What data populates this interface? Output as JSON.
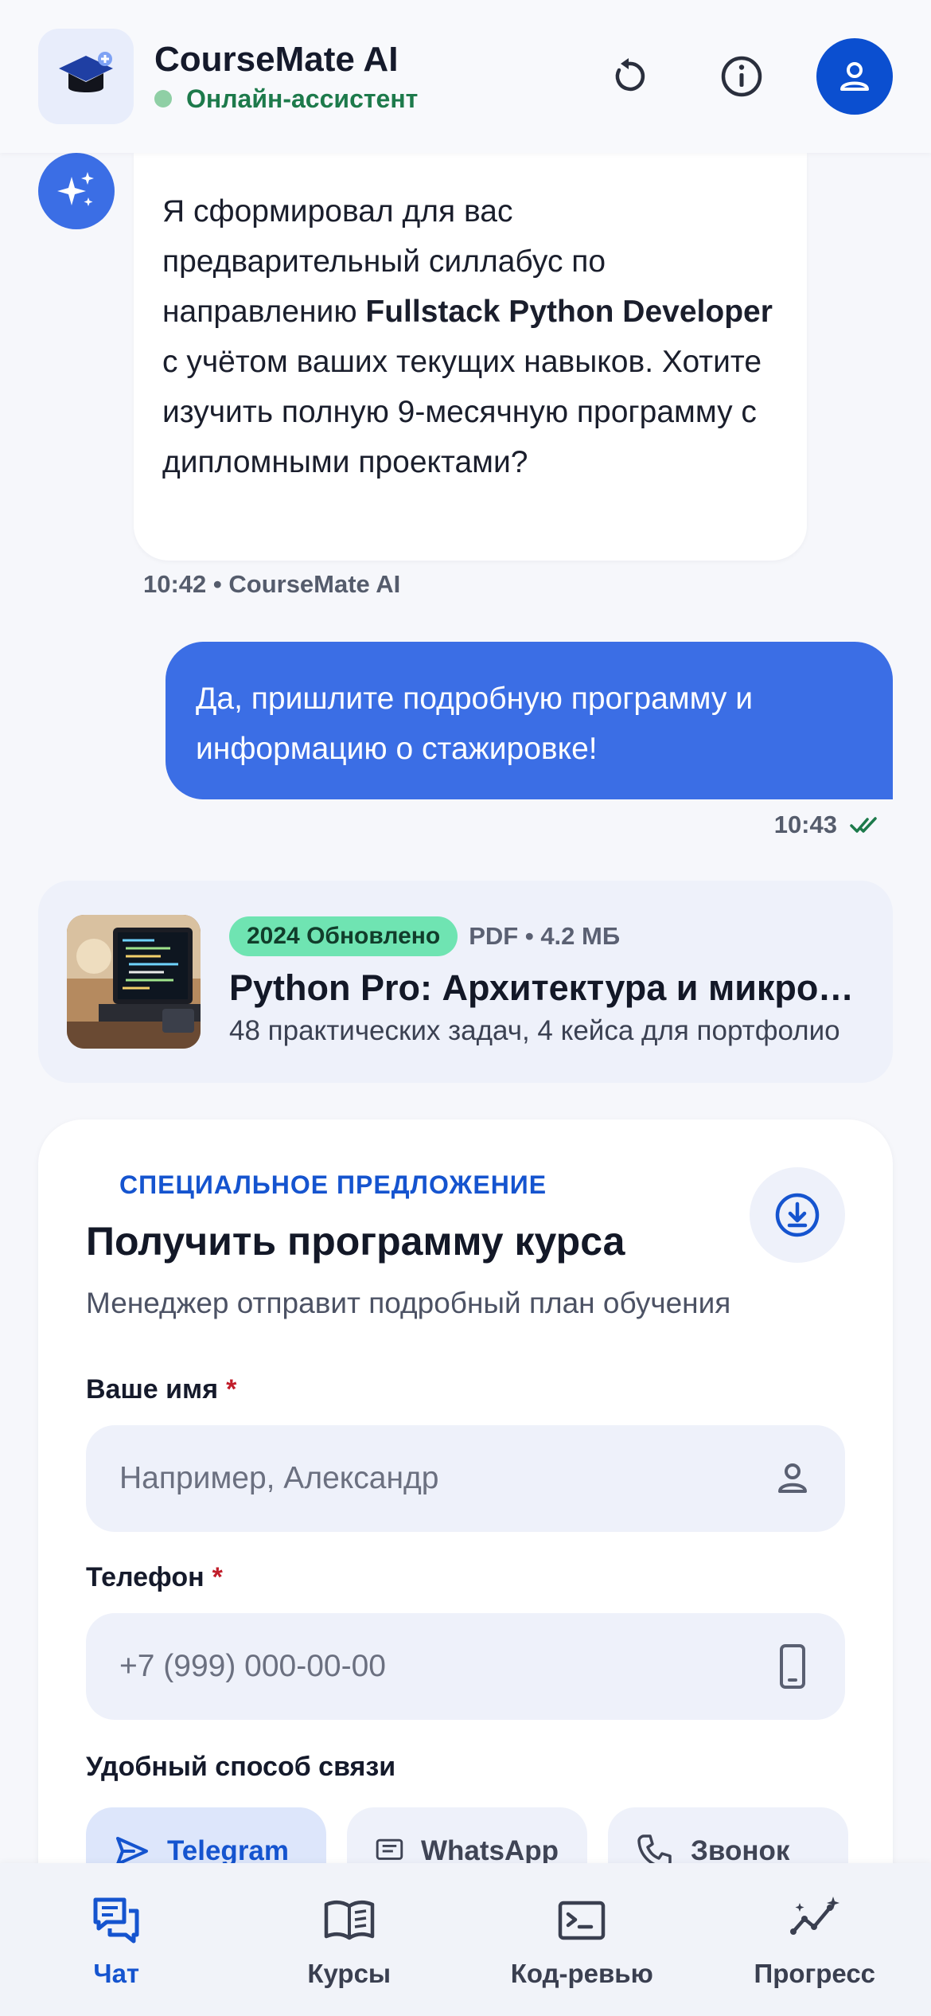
{
  "header": {
    "title": "CourseMate AI",
    "status": "Онлайн-ассистент",
    "status_color": "#1d7a4b",
    "icons": [
      "graduation-cap-icon",
      "refresh-icon",
      "info-icon",
      "user-icon"
    ]
  },
  "chat": {
    "ai_message": {
      "text_before": "Я сформировал для вас предварительный силлабус по направлению ",
      "highlight": "Fullstack Python Developer",
      "text_after": " с учётом ваших текущих навыков. Хотите изучить полную 9-месячную программу с дипломными проектами?",
      "meta": "10:42 • CourseMate AI"
    },
    "user_message": {
      "text": "Да, пришлите подробную программу и информацию о стажировке!",
      "time": "10:43",
      "read_icon": "double-check-icon"
    }
  },
  "file": {
    "badge": "2024 Обновлено",
    "meta": "PDF • 4.2 МБ",
    "title": "Python Pro: Архитектура и микросервисы",
    "subtitle": "48 практических задач, 4 кейса для портфолио"
  },
  "form": {
    "offer_label": "СПЕЦИАЛЬНОЕ ПРЕДЛОЖЕНИЕ",
    "title": "Получить программу курса",
    "subtitle": "Менеджер отправит подробный план обучения",
    "name_label": "Ваше имя",
    "name_placeholder": "Например, Александр",
    "phone_label": "Телефон",
    "phone_placeholder": "+7 (999) 000-00-00",
    "required_mark": "*",
    "contact_label": "Удобный способ связи",
    "contact_options": [
      "Telegram",
      "WhatsApp",
      "Звонок"
    ],
    "selected_contact": "Telegram"
  },
  "nav": {
    "items": [
      {
        "label": "Чат",
        "icon": "chat-icon",
        "active": true
      },
      {
        "label": "Курсы",
        "icon": "book-icon",
        "active": false
      },
      {
        "label": "Код-ревью",
        "icon": "terminal-icon",
        "active": false
      },
      {
        "label": "Прогресс",
        "icon": "progress-icon",
        "active": false
      }
    ]
  },
  "colors": {
    "accent": "#3b6ee5",
    "accent_dark": "#0b4fd0",
    "badge_green": "#6fe4b2",
    "required_red": "#c11d2a"
  }
}
